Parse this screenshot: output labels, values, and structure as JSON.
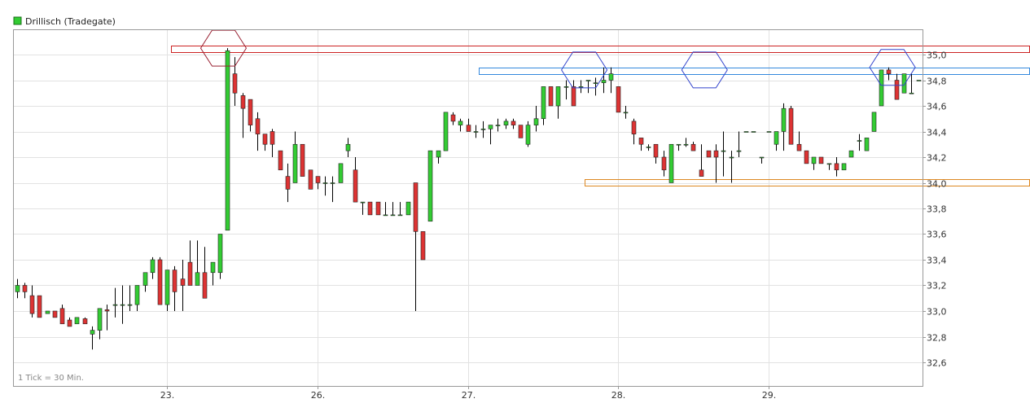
{
  "chart_data": {
    "type": "candlestick",
    "legend": {
      "label": "Drillisch (Tradegate)",
      "color": "#33cc33",
      "position": "top-left"
    },
    "footnote": "1 Tick = 30 Min.",
    "grid": true,
    "ylim": [
      32.5,
      35.2
    ],
    "y_ticks": [
      "35,0",
      "34,8",
      "34,6",
      "34,4",
      "34,2",
      "34,0",
      "33,8",
      "33,6",
      "33,4",
      "33,2",
      "33,0",
      "32,8",
      "32,6"
    ],
    "y_tick_values": [
      35.0,
      34.8,
      34.6,
      34.4,
      34.2,
      34.0,
      33.8,
      33.6,
      33.4,
      33.2,
      33.0,
      32.8,
      32.6
    ],
    "x_ticks": [
      "23.",
      "26.",
      "27.",
      "28.",
      "29."
    ],
    "x_tick_positions": [
      20.5,
      40.5,
      60.5,
      80.5,
      100.5
    ],
    "bars_count": 121,
    "colors": {
      "up": "#33cc33",
      "down": "#dd3333",
      "wick": "#000000"
    },
    "candles": [
      [
        33.15,
        33.25,
        33.1,
        33.2
      ],
      [
        33.2,
        33.22,
        33.1,
        33.15
      ],
      [
        33.12,
        33.2,
        32.95,
        32.98
      ],
      [
        33.12,
        33.12,
        32.95,
        32.95
      ],
      [
        32.98,
        33.0,
        32.98,
        33.0
      ],
      [
        33.0,
        33.0,
        32.95,
        32.95
      ],
      [
        33.02,
        33.05,
        32.9,
        32.9
      ],
      [
        32.93,
        32.95,
        32.88,
        32.88
      ],
      [
        32.9,
        32.95,
        32.9,
        32.95
      ],
      [
        32.94,
        32.95,
        32.9,
        32.9
      ],
      [
        32.82,
        32.88,
        32.7,
        32.85
      ],
      [
        32.85,
        33.02,
        32.78,
        33.02
      ],
      [
        33.01,
        33.05,
        32.85,
        33.0
      ],
      [
        33.05,
        33.18,
        32.95,
        33.05
      ],
      [
        33.05,
        33.2,
        32.9,
        33.05
      ],
      [
        33.05,
        33.2,
        33.0,
        33.05
      ],
      [
        33.05,
        33.2,
        33.0,
        33.2
      ],
      [
        33.2,
        33.3,
        33.15,
        33.3
      ],
      [
        33.3,
        33.42,
        33.25,
        33.4
      ],
      [
        33.4,
        33.42,
        33.05,
        33.05
      ],
      [
        33.05,
        33.32,
        33.0,
        33.32
      ],
      [
        33.32,
        33.35,
        33.0,
        33.15
      ],
      [
        33.25,
        33.4,
        33.0,
        33.2
      ],
      [
        33.38,
        33.55,
        33.2,
        33.2
      ],
      [
        33.2,
        33.55,
        33.2,
        33.3
      ],
      [
        33.3,
        33.5,
        33.1,
        33.1
      ],
      [
        33.3,
        33.38,
        33.2,
        33.38
      ],
      [
        33.3,
        33.6,
        33.25,
        33.6
      ],
      [
        33.63,
        35.05,
        33.63,
        35.03
      ],
      [
        34.85,
        34.98,
        34.6,
        34.7
      ],
      [
        34.68,
        34.7,
        34.35,
        34.58
      ],
      [
        34.65,
        34.65,
        34.4,
        34.45
      ],
      [
        34.5,
        34.55,
        34.25,
        34.38
      ],
      [
        34.38,
        34.38,
        34.25,
        34.3
      ],
      [
        34.4,
        34.42,
        34.2,
        34.3
      ],
      [
        34.25,
        34.25,
        34.1,
        34.1
      ],
      [
        34.05,
        34.15,
        33.85,
        33.95
      ],
      [
        34.0,
        34.4,
        34.0,
        34.3
      ],
      [
        34.3,
        34.3,
        34.05,
        34.05
      ],
      [
        34.1,
        34.1,
        33.95,
        33.95
      ],
      [
        34.05,
        34.05,
        33.95,
        34.0
      ],
      [
        34.0,
        34.05,
        33.9,
        34.0
      ],
      [
        34.0,
        34.05,
        33.85,
        34.0
      ],
      [
        34.0,
        34.15,
        34.0,
        34.15
      ],
      [
        34.25,
        34.35,
        34.2,
        34.3
      ],
      [
        34.1,
        34.2,
        33.85,
        33.85
      ],
      [
        33.85,
        33.85,
        33.75,
        33.85
      ],
      [
        33.85,
        33.85,
        33.75,
        33.75
      ],
      [
        33.85,
        33.85,
        33.75,
        33.75
      ],
      [
        33.75,
        33.85,
        33.75,
        33.75
      ],
      [
        33.75,
        33.85,
        33.75,
        33.75
      ],
      [
        33.75,
        33.85,
        33.75,
        33.75
      ],
      [
        33.75,
        33.85,
        33.75,
        33.85
      ],
      [
        34.0,
        34.0,
        33.0,
        33.62
      ],
      [
        33.62,
        33.62,
        33.4,
        33.4
      ],
      [
        33.7,
        34.25,
        33.7,
        34.25
      ],
      [
        34.2,
        34.25,
        34.15,
        34.25
      ],
      [
        34.25,
        34.55,
        34.25,
        34.55
      ],
      [
        34.53,
        34.55,
        34.45,
        34.48
      ],
      [
        34.45,
        34.5,
        34.4,
        34.48
      ],
      [
        34.45,
        34.5,
        34.4,
        34.4
      ],
      [
        34.4,
        34.45,
        34.35,
        34.4
      ],
      [
        34.42,
        34.48,
        34.35,
        34.42
      ],
      [
        34.42,
        34.45,
        34.3,
        34.45
      ],
      [
        34.45,
        34.5,
        34.4,
        34.45
      ],
      [
        34.45,
        34.5,
        34.42,
        34.48
      ],
      [
        34.48,
        34.5,
        34.42,
        34.45
      ],
      [
        34.45,
        34.45,
        34.35,
        34.35
      ],
      [
        34.3,
        34.48,
        34.28,
        34.45
      ],
      [
        34.45,
        34.6,
        34.4,
        34.5
      ],
      [
        34.5,
        34.75,
        34.45,
        34.75
      ],
      [
        34.75,
        34.75,
        34.6,
        34.6
      ],
      [
        34.6,
        34.75,
        34.5,
        34.75
      ],
      [
        34.75,
        34.8,
        34.65,
        34.75
      ],
      [
        34.75,
        34.8,
        34.6,
        34.6
      ],
      [
        34.75,
        34.8,
        34.7,
        34.75
      ],
      [
        34.8,
        34.8,
        34.7,
        34.8
      ],
      [
        34.78,
        34.82,
        34.68,
        34.78
      ],
      [
        34.78,
        34.9,
        34.7,
        34.8
      ],
      [
        34.8,
        34.9,
        34.7,
        34.85
      ],
      [
        34.75,
        34.75,
        34.55,
        34.55
      ],
      [
        34.55,
        34.6,
        34.5,
        34.55
      ],
      [
        34.48,
        34.5,
        34.3,
        34.38
      ],
      [
        34.35,
        34.35,
        34.25,
        34.3
      ],
      [
        34.28,
        34.3,
        34.25,
        34.28
      ],
      [
        34.3,
        34.3,
        34.15,
        34.2
      ],
      [
        34.2,
        34.25,
        34.05,
        34.1
      ],
      [
        34.0,
        34.3,
        34.0,
        34.3
      ],
      [
        34.3,
        34.3,
        34.25,
        34.3
      ],
      [
        34.3,
        34.35,
        34.28,
        34.3
      ],
      [
        34.3,
        34.32,
        34.25,
        34.25
      ],
      [
        34.1,
        34.3,
        34.05,
        34.05
      ],
      [
        34.25,
        34.25,
        34.2,
        34.2
      ],
      [
        34.25,
        34.3,
        34.0,
        34.2
      ],
      [
        34.25,
        34.4,
        34.05,
        34.25
      ],
      [
        34.2,
        34.25,
        34.0,
        34.2
      ],
      [
        34.25,
        34.4,
        34.2,
        34.25
      ],
      [
        34.4,
        34.4,
        34.4,
        34.4
      ],
      [
        34.4,
        34.4,
        34.4,
        34.4
      ],
      [
        34.2,
        34.2,
        34.15,
        34.2
      ],
      [
        34.4,
        34.4,
        34.4,
        34.4
      ],
      [
        34.3,
        34.4,
        34.25,
        34.4
      ],
      [
        34.4,
        34.62,
        34.25,
        34.58
      ],
      [
        34.58,
        34.6,
        34.3,
        34.3
      ],
      [
        34.3,
        34.4,
        34.25,
        34.25
      ],
      [
        34.25,
        34.25,
        34.15,
        34.15
      ],
      [
        34.15,
        34.2,
        34.1,
        34.2
      ],
      [
        34.2,
        34.2,
        34.15,
        34.15
      ],
      [
        34.15,
        34.15,
        34.1,
        34.15
      ],
      [
        34.15,
        34.2,
        34.05,
        34.1
      ],
      [
        34.1,
        34.15,
        34.1,
        34.15
      ],
      [
        34.2,
        34.25,
        34.2,
        34.25
      ],
      [
        34.33,
        34.38,
        34.25,
        34.33
      ],
      [
        34.25,
        34.35,
        34.25,
        34.35
      ],
      [
        34.4,
        34.55,
        34.4,
        34.55
      ],
      [
        34.6,
        34.88,
        34.6,
        34.88
      ],
      [
        34.88,
        34.9,
        34.8,
        34.85
      ],
      [
        34.8,
        34.85,
        34.65,
        34.65
      ],
      [
        34.7,
        34.85,
        34.7,
        34.85
      ],
      [
        34.7,
        34.85,
        34.7,
        34.7
      ],
      [
        34.8,
        34.8,
        34.8,
        34.8
      ]
    ],
    "resistance_zones": [
      {
        "low": 35.02,
        "high": 35.07,
        "from": 21,
        "to": 121,
        "color": "#cc2222"
      },
      {
        "low": 34.85,
        "high": 34.9,
        "from": 62,
        "to": 121,
        "color": "#3388dd"
      }
    ],
    "support_zones": [
      {
        "low": 33.98,
        "high": 34.03,
        "from": 76,
        "to": 121,
        "color": "#dd8822"
      }
    ],
    "highlight_markers": [
      {
        "bar": 28.0,
        "price": 35.05,
        "color": "#992233"
      },
      {
        "bar": 76.0,
        "price": 34.88,
        "color": "#3344cc"
      },
      {
        "bar": 92.0,
        "price": 34.88,
        "color": "#3344cc"
      },
      {
        "bar": 117.0,
        "price": 34.9,
        "color": "#3344cc"
      }
    ]
  }
}
